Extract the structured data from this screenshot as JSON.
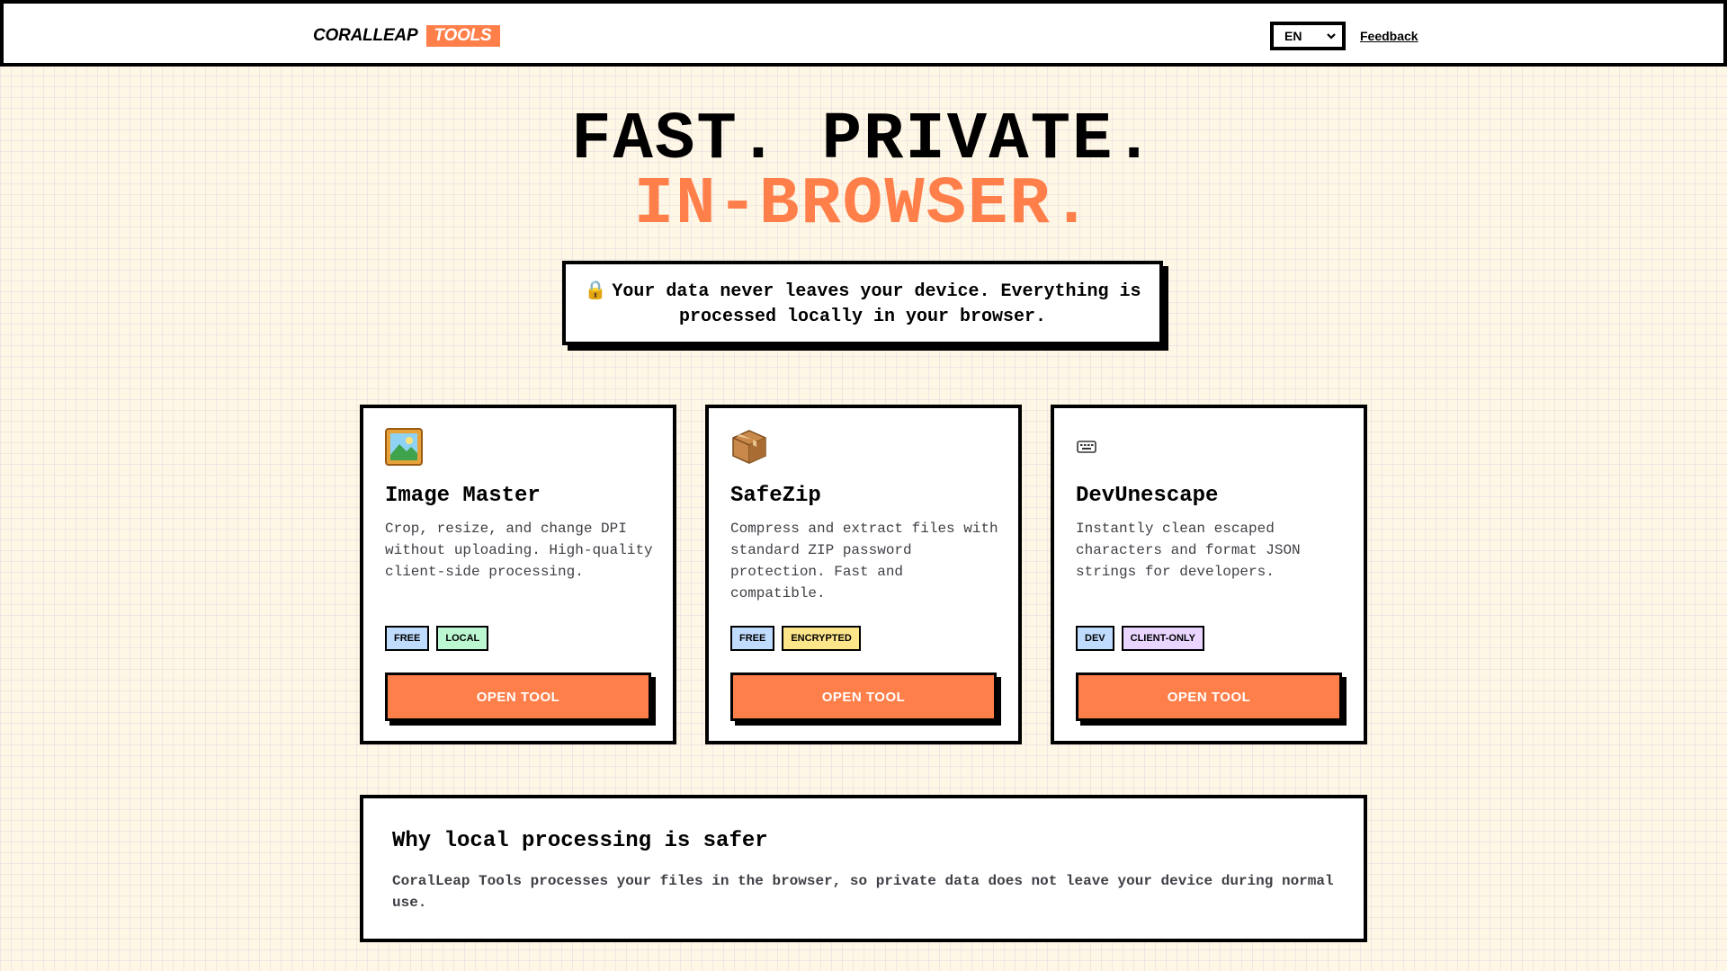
{
  "header": {
    "logo_main": "CORALLEAP",
    "logo_tag": "TOOLS",
    "language": "EN",
    "feedback_label": "Feedback"
  },
  "hero": {
    "line1": "FAST. PRIVATE.",
    "line2": "IN-BROWSER.",
    "notice": "Your data never leaves your device. Everything is processed locally in your browser.",
    "notice_icon": "lock-icon"
  },
  "tools": [
    {
      "icon": "framed-picture-icon",
      "title": "Image Master",
      "description": "Crop, resize, and change DPI without uploading. High-quality client-side processing.",
      "tags": [
        {
          "label": "FREE",
          "color": "#bfdbfe"
        },
        {
          "label": "LOCAL",
          "color": "#bbf7d0"
        }
      ],
      "button": "OPEN TOOL"
    },
    {
      "icon": "package-icon",
      "title": "SafeZip",
      "description": "Compress and extract files with standard ZIP password protection. Fast and compatible.",
      "tags": [
        {
          "label": "FREE",
          "color": "#bfdbfe"
        },
        {
          "label": "ENCRYPTED",
          "color": "#fde68a"
        }
      ],
      "button": "OPEN TOOL"
    },
    {
      "icon": "keyboard-icon",
      "title": "DevUnescape",
      "description": "Instantly clean escaped characters and format JSON strings for developers.",
      "tags": [
        {
          "label": "DEV",
          "color": "#bfdbfe"
        },
        {
          "label": "CLIENT-ONLY",
          "color": "#e9d5ff"
        }
      ],
      "button": "OPEN TOOL"
    }
  ],
  "why": {
    "title": "Why local processing is safer",
    "body": "CoralLeap Tools processes your files in the browser, so private data does not leave your device during normal use."
  },
  "colors": {
    "accent": "#ff7f4a",
    "background": "#fff7e6",
    "border": "#000000"
  }
}
